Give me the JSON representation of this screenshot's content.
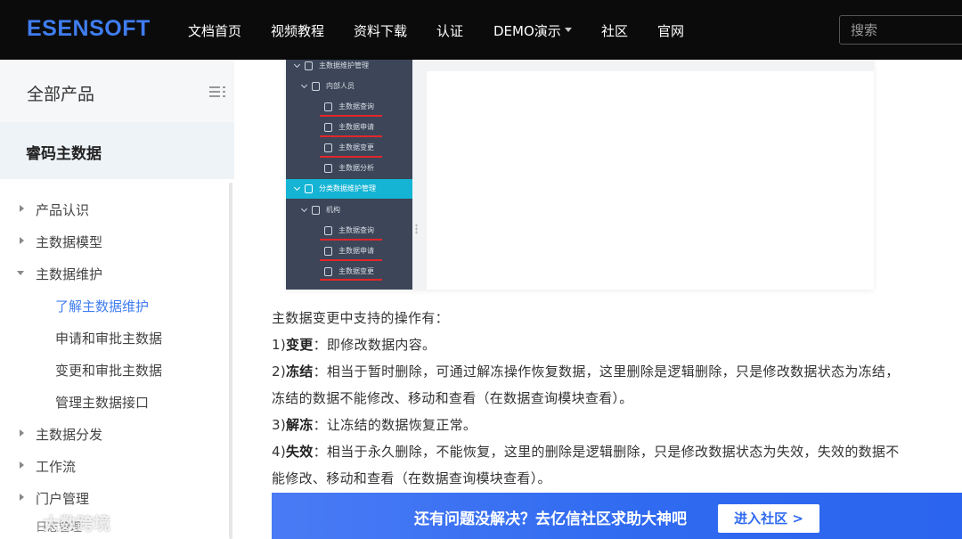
{
  "header": {
    "logo": "ESENSOFT",
    "nav": [
      "文档首页",
      "视频教程",
      "资料下载",
      "认证",
      "DEMO演示",
      "社区",
      "官网"
    ],
    "search_placeholder": "搜索"
  },
  "sidebar": {
    "title": "全部产品",
    "product": "睿码主数据",
    "tree": [
      {
        "label": "产品认识",
        "expanded": false
      },
      {
        "label": "主数据模型",
        "expanded": false
      },
      {
        "label": "主数据维护",
        "expanded": true
      },
      {
        "label": "了解主数据维护",
        "active": true
      },
      {
        "label": "申请和审批主数据"
      },
      {
        "label": "变更和审批主数据"
      },
      {
        "label": "管理主数据接口"
      },
      {
        "label": "主数据分发",
        "expanded": false
      },
      {
        "label": "工作流",
        "expanded": false
      },
      {
        "label": "门户管理",
        "expanded": false
      },
      {
        "label": "日志管理"
      }
    ]
  },
  "screenshot": {
    "rows": [
      "主数据维护管理",
      "内部人员",
      "主数据查询",
      "主数据申请",
      "主数据变更",
      "主数据分析",
      "分类数据维护管理",
      "机构",
      "主数据查询",
      "主数据申请",
      "主数据变更"
    ],
    "highlight_color": "#15b4d4",
    "underline_color": "#e2262b"
  },
  "content": {
    "intro": "主数据变更中支持的操作有：",
    "ops": [
      {
        "prefix": "1)",
        "term": "变更",
        "sep": "：",
        "text": "即修改数据内容。"
      },
      {
        "prefix": "2)",
        "term": "冻结",
        "sep": "：",
        "text": "相当于暂时删除，可通过解冻操作恢复数据，这里删除是逻辑删除，只是修改数据状态为冻结，",
        "cont": "冻结的数据不能修改、移动和查看（在数据查询模块查看）。"
      },
      {
        "prefix": "3)",
        "term": "解冻",
        "sep": "：",
        "text": "让冻结的数据恢复正常。"
      },
      {
        "prefix": "4)",
        "term": "失效",
        "sep": "：",
        "text": "相当于永久删除，不能恢复，这里的删除是逻辑删除，只是修改数据状态为失效，失效的数据不",
        "cont": "能修改、移动和查看（在数据查询模块查看）。"
      }
    ]
  },
  "banner": {
    "text": "还有问题没解决？去亿信社区求助大神吧",
    "button": "进入社区 >"
  },
  "watermark": "大数跨境",
  "colors": {
    "brand": "#3f7df0",
    "nav_bg": "#0b0b0b",
    "banner": "#2f6af0"
  }
}
